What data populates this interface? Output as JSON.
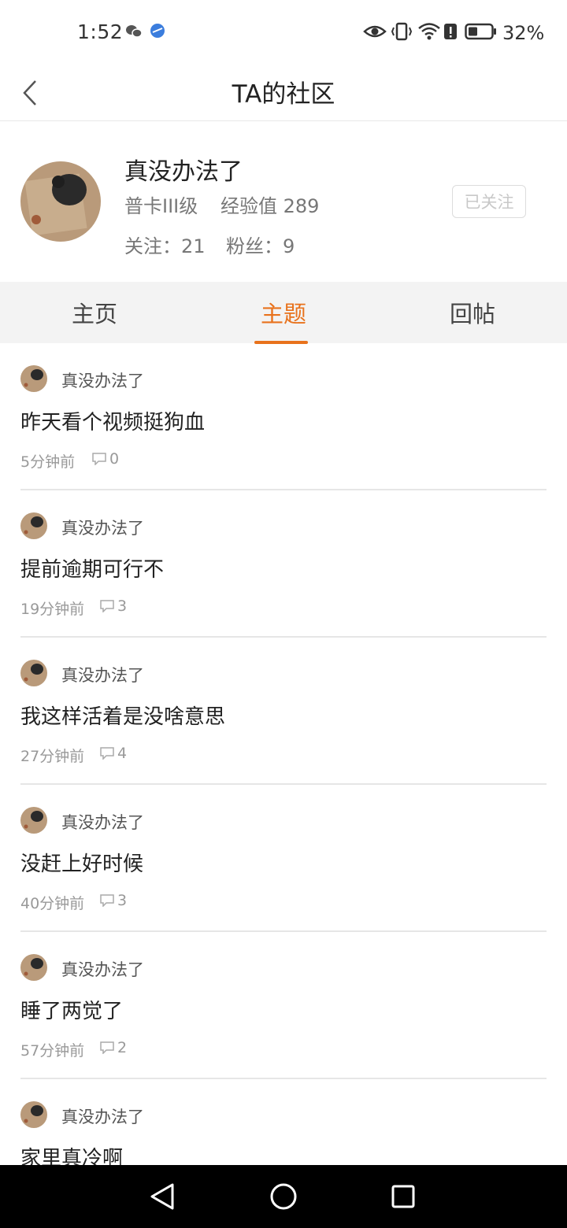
{
  "status_bar": {
    "time": "1:52",
    "battery_percent": "32%",
    "icons": [
      "wechat-icon",
      "browser-icon",
      "eye-icon",
      "vibrate-icon",
      "wifi-icon",
      "alert-icon",
      "battery-icon"
    ]
  },
  "header": {
    "title": "TA的社区"
  },
  "profile": {
    "name": "真没办法了",
    "level": "普卡III级",
    "exp": "经验值 289",
    "follow": "关注：21",
    "fans": "粉丝：9",
    "followed_label": "已关注"
  },
  "tabs": [
    {
      "label": "主页",
      "active": false
    },
    {
      "label": "主题",
      "active": true
    },
    {
      "label": "回帖",
      "active": false
    }
  ],
  "posts": [
    {
      "author": "真没办法了",
      "title": "昨天看个视频挺狗血",
      "time": "5分钟前",
      "comments": "0"
    },
    {
      "author": "真没办法了",
      "title": "提前逾期可行不",
      "time": "19分钟前",
      "comments": "3"
    },
    {
      "author": "真没办法了",
      "title": "我这样活着是没啥意思",
      "time": "27分钟前",
      "comments": "4"
    },
    {
      "author": "真没办法了",
      "title": "没赶上好时候",
      "time": "40分钟前",
      "comments": "3"
    },
    {
      "author": "真没办法了",
      "title": "睡了两觉了",
      "time": "57分钟前",
      "comments": "2"
    },
    {
      "author": "真没办法了",
      "title": "家里真冷啊",
      "time": "",
      "comments": ""
    }
  ],
  "colors": {
    "accent": "#e8721c",
    "tab_bar_bg": "#f3f3f3",
    "nav_bar_bg": "#000000"
  }
}
